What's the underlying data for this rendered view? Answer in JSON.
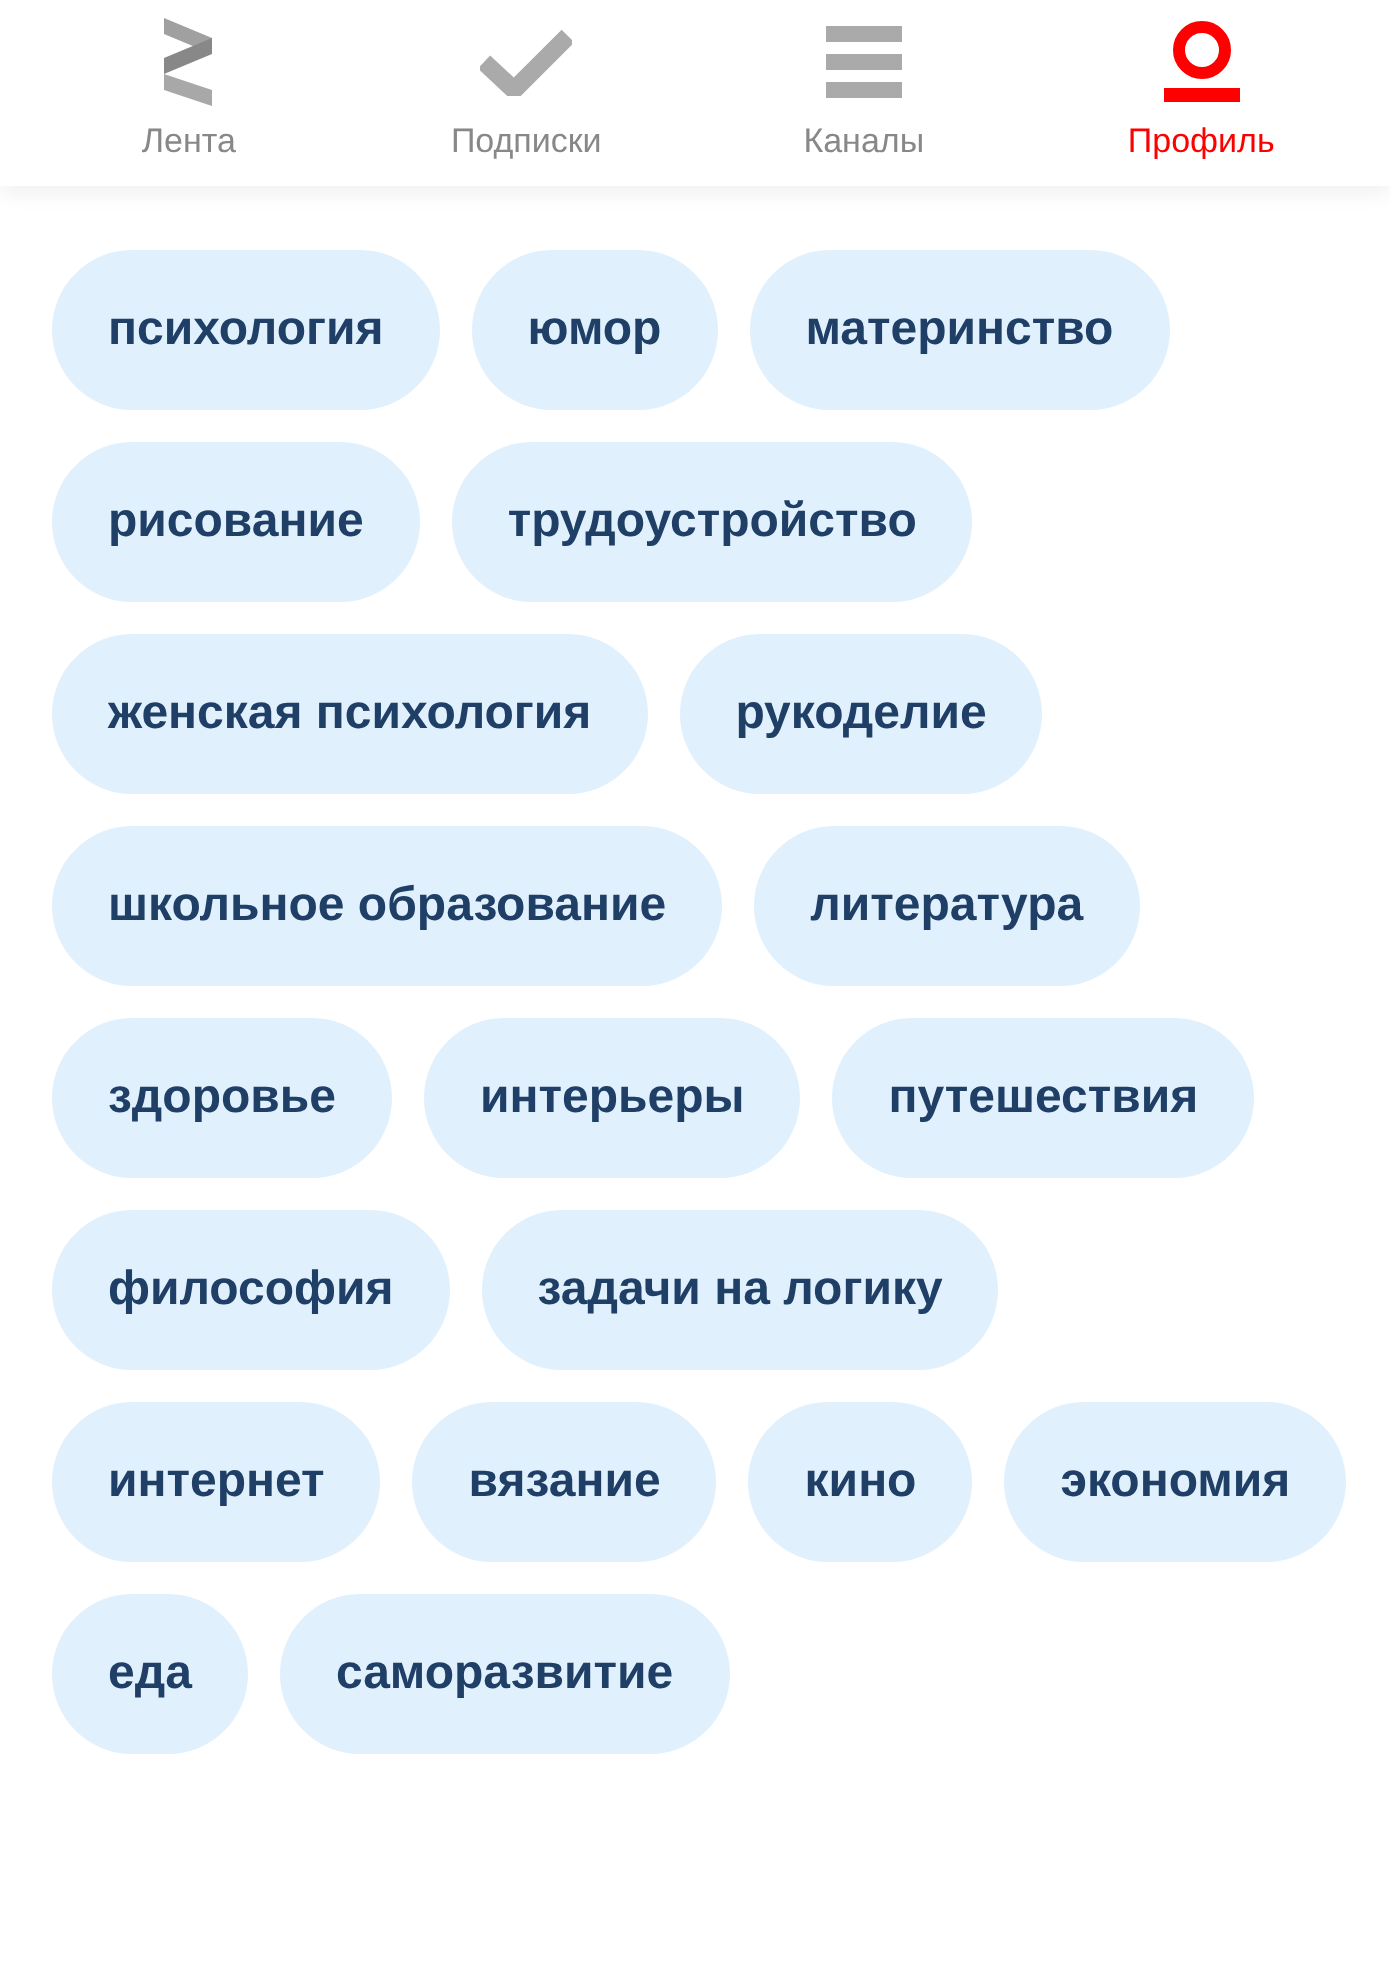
{
  "tabs": [
    {
      "label": "Лента",
      "kind": "feed",
      "selected": false
    },
    {
      "label": "Подписки",
      "kind": "subscriptions",
      "selected": false
    },
    {
      "label": "Каналы",
      "kind": "channels",
      "selected": false
    },
    {
      "label": "Профиль",
      "kind": "profile",
      "selected": true
    }
  ],
  "tags": [
    "психология",
    "юмор",
    "материнство",
    "рисование",
    "трудоустройство",
    "женская психология",
    "рукоделие",
    "школьное образование",
    "литература",
    "здоровье",
    "интерьеры",
    "путешествия",
    "философия",
    "задачи на логику",
    "интернет",
    "вязание",
    "кино",
    "экономия",
    "еда",
    "саморазвитие"
  ]
}
